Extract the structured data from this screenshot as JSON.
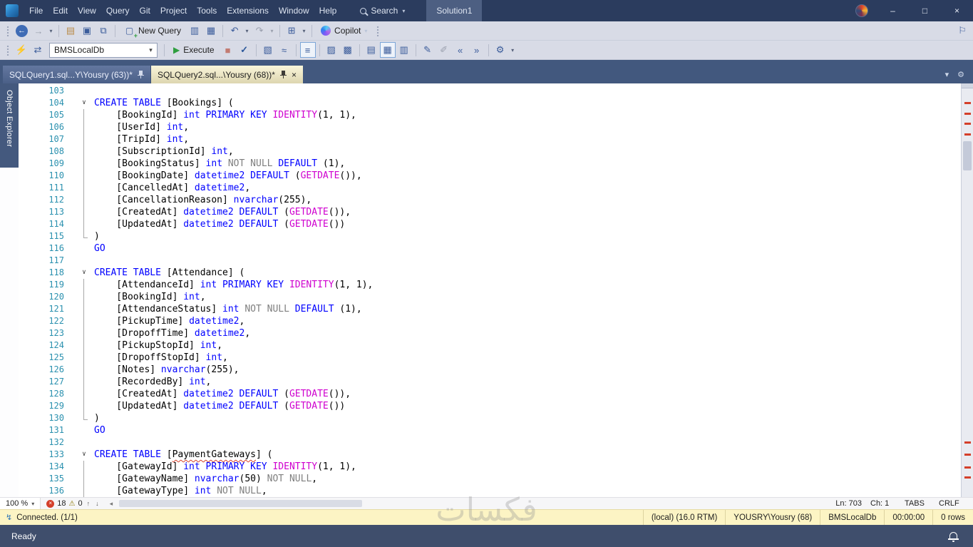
{
  "window": {
    "minimize": "–",
    "maximize": "□",
    "close": "×"
  },
  "title_bar": {
    "menus": [
      "File",
      "Edit",
      "View",
      "Query",
      "Git",
      "Project",
      "Tools",
      "Extensions",
      "Window",
      "Help"
    ],
    "search": "Search",
    "solution": "Solution1"
  },
  "toolbar1": {
    "new_query": "New Query",
    "copilot": "Copilot"
  },
  "toolbar2": {
    "database": "BMSLocalDb",
    "execute": "Execute"
  },
  "tab_strip": {
    "tabs": [
      {
        "label": "SQLQuery1.sql...Y\\Yousry (63))*",
        "active": false
      },
      {
        "label": "SQLQuery2.sql...\\Yousry (68))*",
        "active": true
      }
    ]
  },
  "side": {
    "object_explorer": "Object Explorer"
  },
  "editor": {
    "lines": [
      {
        "n": 103,
        "seg": []
      },
      {
        "n": 104,
        "fold": "start",
        "seg": [
          [
            "CREATE TABLE",
            "k"
          ],
          [
            " [Bookings] (",
            "p"
          ]
        ]
      },
      {
        "n": 105,
        "fold": "mid",
        "seg": [
          [
            "    [BookingId] ",
            "p"
          ],
          [
            "int PRIMARY KEY ",
            "k"
          ],
          [
            "IDENTITY",
            "f"
          ],
          [
            "(1, 1),",
            "p"
          ]
        ]
      },
      {
        "n": 106,
        "fold": "mid",
        "seg": [
          [
            "    [UserId] ",
            "p"
          ],
          [
            "int",
            "k"
          ],
          [
            ",",
            "p"
          ]
        ]
      },
      {
        "n": 107,
        "fold": "mid",
        "seg": [
          [
            "    [TripId] ",
            "p"
          ],
          [
            "int",
            "k"
          ],
          [
            ",",
            "p"
          ]
        ]
      },
      {
        "n": 108,
        "fold": "mid",
        "seg": [
          [
            "    [SubscriptionId] ",
            "p"
          ],
          [
            "int",
            "k"
          ],
          [
            ",",
            "p"
          ]
        ]
      },
      {
        "n": 109,
        "fold": "mid",
        "seg": [
          [
            "    [BookingStatus] ",
            "p"
          ],
          [
            "int ",
            "k"
          ],
          [
            "NOT NULL ",
            "o"
          ],
          [
            "DEFAULT",
            "k"
          ],
          [
            " (1),",
            "p"
          ]
        ]
      },
      {
        "n": 110,
        "fold": "mid",
        "seg": [
          [
            "    [BookingDate] ",
            "p"
          ],
          [
            "datetime2 DEFAULT",
            "k"
          ],
          [
            " (",
            "p"
          ],
          [
            "GETDATE",
            "f"
          ],
          [
            "()),",
            "p"
          ]
        ]
      },
      {
        "n": 111,
        "fold": "mid",
        "seg": [
          [
            "    [CancelledAt] ",
            "p"
          ],
          [
            "datetime2",
            "k"
          ],
          [
            ",",
            "p"
          ]
        ]
      },
      {
        "n": 112,
        "fold": "mid",
        "seg": [
          [
            "    [CancellationReason] ",
            "p"
          ],
          [
            "nvarchar",
            "k"
          ],
          [
            "(255),",
            "p"
          ]
        ]
      },
      {
        "n": 113,
        "fold": "mid",
        "seg": [
          [
            "    [CreatedAt] ",
            "p"
          ],
          [
            "datetime2 DEFAULT",
            "k"
          ],
          [
            " (",
            "p"
          ],
          [
            "GETDATE",
            "f"
          ],
          [
            "()),",
            "p"
          ]
        ]
      },
      {
        "n": 114,
        "fold": "mid",
        "seg": [
          [
            "    [UpdatedAt] ",
            "p"
          ],
          [
            "datetime2 DEFAULT",
            "k"
          ],
          [
            " (",
            "p"
          ],
          [
            "GETDATE",
            "f"
          ],
          [
            "())",
            "p"
          ]
        ]
      },
      {
        "n": 115,
        "fold": "end",
        "seg": [
          [
            ")",
            "p"
          ]
        ]
      },
      {
        "n": 116,
        "seg": [
          [
            "GO",
            "k"
          ]
        ]
      },
      {
        "n": 117,
        "seg": []
      },
      {
        "n": 118,
        "fold": "start",
        "seg": [
          [
            "CREATE TABLE",
            "k"
          ],
          [
            " [Attendance] (",
            "p"
          ]
        ]
      },
      {
        "n": 119,
        "fold": "mid",
        "seg": [
          [
            "    [AttendanceId] ",
            "p"
          ],
          [
            "int PRIMARY KEY ",
            "k"
          ],
          [
            "IDENTITY",
            "f"
          ],
          [
            "(1, 1),",
            "p"
          ]
        ]
      },
      {
        "n": 120,
        "fold": "mid",
        "seg": [
          [
            "    [BookingId] ",
            "p"
          ],
          [
            "int",
            "k"
          ],
          [
            ",",
            "p"
          ]
        ]
      },
      {
        "n": 121,
        "fold": "mid",
        "seg": [
          [
            "    [AttendanceStatus] ",
            "p"
          ],
          [
            "int ",
            "k"
          ],
          [
            "NOT NULL ",
            "o"
          ],
          [
            "DEFAULT",
            "k"
          ],
          [
            " (1),",
            "p"
          ]
        ]
      },
      {
        "n": 122,
        "fold": "mid",
        "seg": [
          [
            "    [PickupTime] ",
            "p"
          ],
          [
            "datetime2",
            "k"
          ],
          [
            ",",
            "p"
          ]
        ]
      },
      {
        "n": 123,
        "fold": "mid",
        "seg": [
          [
            "    [DropoffTime] ",
            "p"
          ],
          [
            "datetime2",
            "k"
          ],
          [
            ",",
            "p"
          ]
        ]
      },
      {
        "n": 124,
        "fold": "mid",
        "seg": [
          [
            "    [PickupStopId] ",
            "p"
          ],
          [
            "int",
            "k"
          ],
          [
            ",",
            "p"
          ]
        ]
      },
      {
        "n": 125,
        "fold": "mid",
        "seg": [
          [
            "    [DropoffStopId] ",
            "p"
          ],
          [
            "int",
            "k"
          ],
          [
            ",",
            "p"
          ]
        ]
      },
      {
        "n": 126,
        "fold": "mid",
        "seg": [
          [
            "    [Notes] ",
            "p"
          ],
          [
            "nvarchar",
            "k"
          ],
          [
            "(255),",
            "p"
          ]
        ]
      },
      {
        "n": 127,
        "fold": "mid",
        "seg": [
          [
            "    [RecordedBy] ",
            "p"
          ],
          [
            "int",
            "k"
          ],
          [
            ",",
            "p"
          ]
        ]
      },
      {
        "n": 128,
        "fold": "mid",
        "seg": [
          [
            "    [CreatedAt] ",
            "p"
          ],
          [
            "datetime2 DEFAULT",
            "k"
          ],
          [
            " (",
            "p"
          ],
          [
            "GETDATE",
            "f"
          ],
          [
            "()),",
            "p"
          ]
        ]
      },
      {
        "n": 129,
        "fold": "mid",
        "seg": [
          [
            "    [UpdatedAt] ",
            "p"
          ],
          [
            "datetime2 DEFAULT",
            "k"
          ],
          [
            " (",
            "p"
          ],
          [
            "GETDATE",
            "f"
          ],
          [
            "())",
            "p"
          ]
        ]
      },
      {
        "n": 130,
        "fold": "end",
        "seg": [
          [
            ")",
            "p"
          ]
        ]
      },
      {
        "n": 131,
        "seg": [
          [
            "GO",
            "k"
          ]
        ]
      },
      {
        "n": 132,
        "seg": []
      },
      {
        "n": 133,
        "fold": "start",
        "seg": [
          [
            "CREATE TABLE",
            "k"
          ],
          [
            " [",
            "p"
          ],
          [
            "PaymentGateways",
            "sq"
          ],
          [
            "] (",
            "p"
          ]
        ]
      },
      {
        "n": 134,
        "fold": "mid",
        "seg": [
          [
            "    [GatewayId] ",
            "p"
          ],
          [
            "int PRIMARY KEY ",
            "k"
          ],
          [
            "IDENTITY",
            "f"
          ],
          [
            "(1, 1),",
            "p"
          ]
        ]
      },
      {
        "n": 135,
        "fold": "mid",
        "seg": [
          [
            "    [GatewayName] ",
            "p"
          ],
          [
            "nvarchar",
            "k"
          ],
          [
            "(50) ",
            "p"
          ],
          [
            "NOT NULL",
            "o"
          ],
          [
            ",",
            "p"
          ]
        ]
      },
      {
        "n": 136,
        "fold": "mid",
        "seg": [
          [
            "    [GatewayType] ",
            "p"
          ],
          [
            "int ",
            "k"
          ],
          [
            "NOT NULL",
            "o"
          ],
          [
            ",",
            "p"
          ]
        ]
      }
    ]
  },
  "scrollbar": {
    "marks": [
      4.5,
      7,
      9.5,
      12,
      86.5,
      89.5,
      92.5,
      95
    ]
  },
  "bottom": {
    "zoom": "100 %",
    "errors": "18",
    "warnings": "0",
    "ln": "Ln: 703",
    "ch": "Ch: 1",
    "tabs": "TABS",
    "eol": "CRLF",
    "connection": "Connected. (1/1)",
    "server": "(local) (16.0 RTM)",
    "user": "YOUSRY\\Yousry (68)",
    "db": "BMSLocalDb",
    "time": "00:00:00",
    "rows": "0 rows",
    "ready": "Ready"
  },
  "watermark": "فكسات",
  "icons": {
    "dropdown": "▾",
    "back": "←",
    "forward": "→",
    "open": "▤",
    "save": "▣",
    "saveall": "⧉",
    "newquery": "▢",
    "newengine": "▥",
    "querydoc": "▦",
    "undo": "↶",
    "redo": "↷",
    "designer": "⊞",
    "feedback": "⚐",
    "connect": "⚡",
    "changeconn": "⇄",
    "execute": "▶",
    "cancel": "■",
    "parse": "✓",
    "estplan": "▧",
    "livestats": "≈",
    "intellisense": "≡",
    "actualplan": "▨",
    "clientstats": "▩",
    "rtext": "▤",
    "rgrid": "▦",
    "rfile": "▥",
    "comment": "✎",
    "uncomment": "✐",
    "outdent": "«",
    "indent": "»",
    "params": "⚙",
    "gear": "⚙",
    "close": "×",
    "scrollleft": "◂",
    "up": "↑",
    "down": "↓",
    "warning": "⚠",
    "errorx": "×",
    "chevron": "∨",
    "connplug": "↯"
  },
  "colors": {
    "titlebar": "#2b3c5e",
    "toolbar": "#d8dbe6",
    "tabstrip": "#42587e",
    "keyword": "#0000ff",
    "function": "#cf00cf",
    "operator": "#7f7f7f",
    "line_number": "#2b91af",
    "error": "#d43f2a",
    "execute_green": "#2f9e3f",
    "status_yellow": "#fcf4c4",
    "statusbar": "#3f4e6c"
  }
}
